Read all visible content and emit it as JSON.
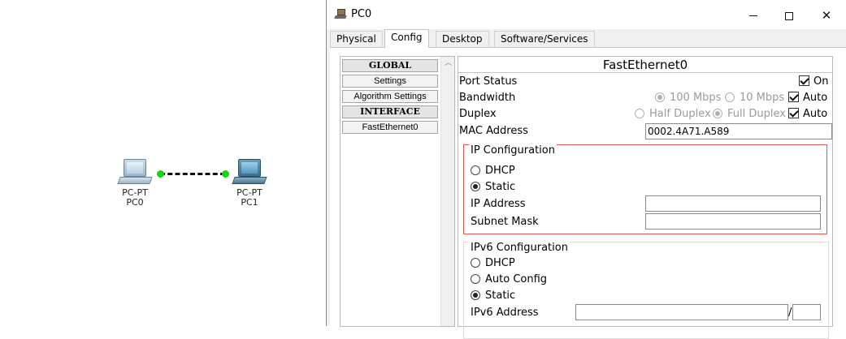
{
  "topology": {
    "devices": [
      {
        "type": "PC-PT",
        "name": "PC0"
      },
      {
        "type": "PC-PT",
        "name": "PC1"
      }
    ],
    "link_color": "#11d611"
  },
  "window": {
    "title": "PC0",
    "tabs": [
      {
        "label": "Physical",
        "active": false
      },
      {
        "label": "Config",
        "active": true
      },
      {
        "label": "Desktop",
        "active": false
      },
      {
        "label": "Software/Services",
        "active": false
      }
    ]
  },
  "nav": {
    "items": [
      {
        "label": "GLOBAL",
        "header": true
      },
      {
        "label": "Settings",
        "header": false
      },
      {
        "label": "Algorithm Settings",
        "header": false
      },
      {
        "label": "INTERFACE",
        "header": true
      },
      {
        "label": "FastEthernet0",
        "header": false
      }
    ]
  },
  "config": {
    "title": "FastEthernet0",
    "port_status": {
      "label": "Port Status",
      "on_label": "On",
      "on": true
    },
    "bandwidth": {
      "label": "Bandwidth",
      "opt1": "100 Mbps",
      "opt2": "10 Mbps",
      "auto_label": "Auto",
      "auto": true
    },
    "duplex": {
      "label": "Duplex",
      "opt1": "Half Duplex",
      "opt2": "Full Duplex",
      "auto_label": "Auto",
      "auto": true
    },
    "mac": {
      "label": "MAC Address",
      "value": "0002.4A71.A589"
    },
    "ipv4": {
      "title": "IP Configuration",
      "dhcp_label": "DHCP",
      "static_label": "Static",
      "selected": "Static",
      "ip_label": "IP Address",
      "ip_value": "",
      "mask_label": "Subnet Mask",
      "mask_value": ""
    },
    "ipv6": {
      "title": "IPv6 Configuration",
      "dhcp_label": "DHCP",
      "auto_label": "Auto Config",
      "static_label": "Static",
      "selected": "Static",
      "addr_label": "IPv6 Address",
      "addr_value": "",
      "slash": "/",
      "prefix_value": ""
    }
  }
}
